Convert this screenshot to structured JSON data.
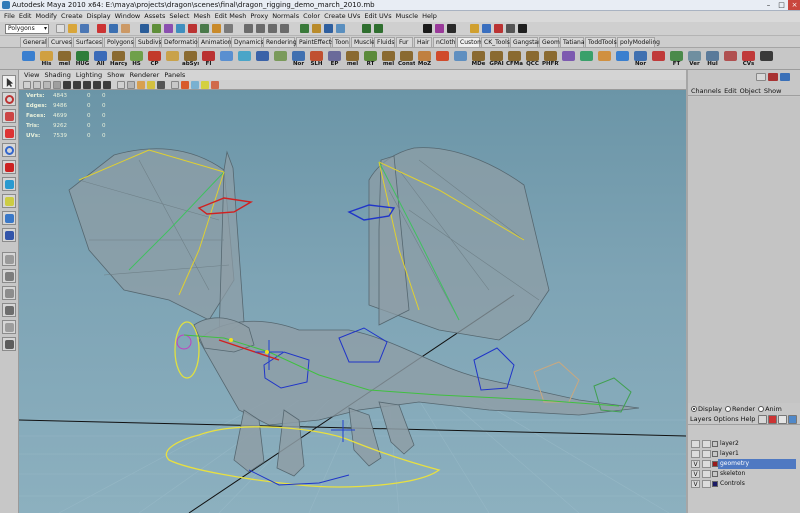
{
  "window": {
    "title": "Autodesk Maya 2010 x64: E:\\maya\\projects\\dragon\\scenes\\final\\dragon_rigging_demo_march_2010.mb"
  },
  "menubar": [
    "File",
    "Edit",
    "Modify",
    "Create",
    "Display",
    "Window",
    "Assets",
    "Select",
    "Mesh",
    "Edit Mesh",
    "Proxy",
    "Normals",
    "Color",
    "Create UVs",
    "Edit UVs",
    "Muscle",
    "Help"
  ],
  "mode_menu": {
    "value": "Polygons"
  },
  "shelf_tabs": [
    "General",
    "Curves",
    "Surfaces",
    "Polygons",
    "Subdivs",
    "Deformation",
    "Animation",
    "Dynamics",
    "Rendering",
    "PaintEffects",
    "Toon",
    "Muscle",
    "Fluids",
    "Fur",
    "Hair",
    "nCloth",
    "Custom",
    "CK_Tools",
    "Gangstar",
    "Geom",
    "Tatiana",
    "ToddTools",
    "polyModeling"
  ],
  "shelf_active_tab": "Custom",
  "shelf_buttons": [
    {
      "label": "",
      "icon": "cube-icon",
      "color": "#3a7fcf"
    },
    {
      "label": "His",
      "icon": "history-icon",
      "color": "#d0a040"
    },
    {
      "label": "mel",
      "icon": "mel-script-icon",
      "color": "#8a6a30"
    },
    {
      "label": "HUG",
      "icon": "hug-icon",
      "color": "#2d7d3a"
    },
    {
      "label": "All",
      "icon": "all-icon",
      "color": "#3a6ab8"
    },
    {
      "label": "Harcy",
      "icon": "mel-script-icon",
      "color": "#8a6a30"
    },
    {
      "label": "HS",
      "icon": "hs-icon",
      "color": "#6fa04a"
    },
    {
      "label": "CP",
      "icon": "cp-icon",
      "color": "#c23a2a"
    },
    {
      "label": "",
      "icon": "tool-icon",
      "color": "#c9a24a"
    },
    {
      "label": "abSys",
      "icon": "mel-script-icon",
      "color": "#8a6a30"
    },
    {
      "label": "FI",
      "icon": "fi-icon",
      "color": "#ba3030"
    },
    {
      "label": "",
      "icon": "mesh-icon",
      "color": "#5a8fd0"
    },
    {
      "label": "",
      "icon": "uv-icon",
      "color": "#4aa5c8"
    },
    {
      "label": "",
      "icon": "paint-icon",
      "color": "#3a62a8"
    },
    {
      "label": "",
      "icon": "tool-icon",
      "color": "#7a9a5a"
    },
    {
      "label": "Nor",
      "icon": "normals-icon",
      "color": "#4070b0"
    },
    {
      "label": "SLH",
      "icon": "slh-icon",
      "color": "#c05030"
    },
    {
      "label": "EP",
      "icon": "ep-icon",
      "color": "#6a6a9a"
    },
    {
      "label": "mel",
      "icon": "mel-script-icon",
      "color": "#8a6a30"
    },
    {
      "label": "RT",
      "icon": "rt-icon",
      "color": "#5a8a3a"
    },
    {
      "label": "mel",
      "icon": "mel-script-icon",
      "color": "#8a6a30"
    },
    {
      "label": "Const",
      "icon": "constraint-icon",
      "color": "#8a6a30"
    },
    {
      "label": "MoZ",
      "icon": "moz-icon",
      "color": "#c08040"
    },
    {
      "label": "",
      "icon": "tool-icon",
      "color": "#d04a2a"
    },
    {
      "label": "",
      "icon": "tool-icon",
      "color": "#5f8fc0"
    },
    {
      "label": "MDe",
      "icon": "mel-script-icon",
      "color": "#8a6a30"
    },
    {
      "label": "GPAI",
      "icon": "mel-script-icon",
      "color": "#8a6a30"
    },
    {
      "label": "CFMa",
      "icon": "mel-script-icon",
      "color": "#8a6a30"
    },
    {
      "label": "QCC",
      "icon": "mel-script-icon",
      "color": "#8a6a30"
    },
    {
      "label": "PHFRT",
      "icon": "mel-script-icon",
      "color": "#8a6a30"
    },
    {
      "label": "",
      "icon": "tool-icon",
      "color": "#7d5ab0"
    },
    {
      "label": "",
      "icon": "tool-icon",
      "color": "#3aa06a"
    },
    {
      "label": "",
      "icon": "tool-icon",
      "color": "#d09040"
    },
    {
      "label": "",
      "icon": "tool-icon",
      "color": "#3a7fcf"
    },
    {
      "label": "Nor",
      "icon": "normals-icon",
      "color": "#4070b0"
    },
    {
      "label": "",
      "icon": "tool-icon",
      "color": "#c03a3a"
    },
    {
      "label": "FT",
      "icon": "ft-icon",
      "color": "#4a8a4a"
    },
    {
      "label": "Ver",
      "icon": "vertex-icon",
      "color": "#6f8fa0"
    },
    {
      "label": "Hul",
      "icon": "hull-icon",
      "color": "#5a7a9a"
    },
    {
      "label": "",
      "icon": "tool-icon",
      "color": "#b05050"
    },
    {
      "label": "CVs",
      "icon": "cv-icon",
      "color": "#c03a3a"
    },
    {
      "label": "",
      "icon": "tool-icon",
      "color": "#3a3a3a"
    }
  ],
  "panel_menu": [
    "View",
    "Shading",
    "Lighting",
    "Show",
    "Renderer",
    "Panels"
  ],
  "hud": {
    "rows": [
      {
        "label": "Verts:",
        "value": "4843",
        "c1": "0",
        "c2": "0"
      },
      {
        "label": "Edges:",
        "value": "9486",
        "c1": "0",
        "c2": "0"
      },
      {
        "label": "Faces:",
        "value": "4699",
        "c1": "0",
        "c2": "0"
      },
      {
        "label": "Tris:",
        "value": "9262",
        "c1": "0",
        "c2": "0"
      },
      {
        "label": "UVs:",
        "value": "7539",
        "c1": "0",
        "c2": "0"
      }
    ]
  },
  "channel_box": {
    "menu": [
      "Channels",
      "Edit",
      "Object",
      "Show"
    ]
  },
  "layer_editor": {
    "modes": [
      {
        "label": "Display",
        "selected": true
      },
      {
        "label": "Render",
        "selected": false
      },
      {
        "label": "Anim",
        "selected": false
      }
    ],
    "menu": [
      "Layers",
      "Options",
      "Help"
    ],
    "layers": [
      {
        "name": "layer2",
        "visible": "",
        "color": "#c7c7c7",
        "selected": false
      },
      {
        "name": "layer1",
        "visible": "",
        "color": "#c7c7c7",
        "selected": false
      },
      {
        "name": "geometry",
        "visible": "V",
        "color": "#9a1a1a",
        "selected": true
      },
      {
        "name": "skeleton",
        "visible": "V",
        "color": "#c7c7c7",
        "selected": false
      },
      {
        "name": "Controls",
        "visible": "V",
        "color": "#1a1a66",
        "selected": false
      }
    ]
  },
  "colors": {
    "viewport_top": "#6b95a7",
    "viewport_bottom": "#8cb0bf",
    "selection_highlight": "#4f79c2"
  }
}
